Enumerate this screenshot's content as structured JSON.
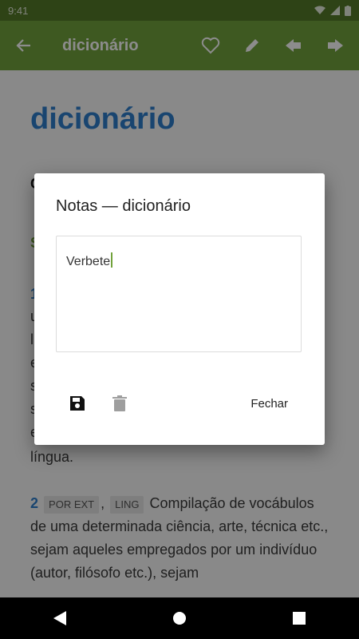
{
  "status_bar": {
    "time": "9:41"
  },
  "app_bar": {
    "title": "dicionário"
  },
  "entry": {
    "headword": "dicionário",
    "obscured_letter_1": "C",
    "obscured_letter_2": "S",
    "obscured_num_1": "1",
    "obscured_letter_3": "u",
    "obscured_letter_4": "l",
    "obscured_letter_5": "e",
    "obscured_letter_6": "s",
    "obscured_letter_7": "s",
    "obscured_letter_8": "e",
    "line_end": "língua.",
    "def2": {
      "number": "2",
      "tag1": "POR EXT",
      "tag2": "LING",
      "text_first": "Compilação de vocábulos",
      "text_rest": "de uma determinada ciência, arte, técnica etc., sejam aqueles empregados por um indivíduo (autor, filósofo etc.), sejam"
    }
  },
  "dialog": {
    "title": "Notas — dicionário",
    "note_text": "Verbete",
    "close_label": "Fechar"
  },
  "colors": {
    "primary": "#72a23c",
    "primary_dark": "#557a28",
    "headword": "#2f7fcc"
  }
}
